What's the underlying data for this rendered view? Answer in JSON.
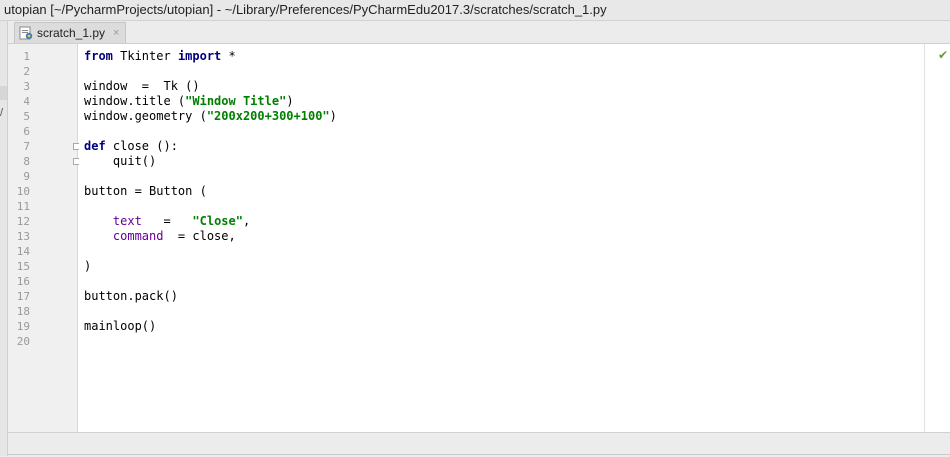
{
  "window": {
    "title": "utopian [~/PycharmProjects/utopian] - ~/Library/Preferences/PyCharmEdu2017.3/scratches/scratch_1.py"
  },
  "tabs": [
    {
      "label": "scratch_1.py",
      "close": "×",
      "icon": "python-file-icon"
    }
  ],
  "left_strip": {
    "marker": "/"
  },
  "editor": {
    "line_numbers": [
      "1",
      "2",
      "3",
      "4",
      "5",
      "6",
      "7",
      "8",
      "9",
      "10",
      "11",
      "12",
      "13",
      "14",
      "15",
      "16",
      "17",
      "18",
      "19",
      "20"
    ],
    "current_line": 20,
    "tokens": {
      "l1_from": "from",
      "l1_mid": " Tkinter ",
      "l1_import": "import",
      "l1_star": " *",
      "l3": "window  =  Tk ()",
      "l4_pre": "window.title (",
      "l4_str": "\"Window Title\"",
      "l4_post": ")",
      "l5_pre": "window.geometry (",
      "l5_str": "\"200x200+300+100\"",
      "l5_post": ")",
      "l7_def": "def",
      "l7_rest": " close ():",
      "l8": "    quit()",
      "l10": "button = Button (",
      "l12_indent": "    ",
      "l12_param": "text",
      "l12_mid": "   =   ",
      "l12_str": "\"Close\"",
      "l12_post": ",",
      "l13_indent": "    ",
      "l13_param": "command",
      "l13_rest": "  = close,",
      "l15": ")",
      "l17": "button.pack()",
      "l19": "mainloop()"
    }
  },
  "status": {
    "check_icon": "check-icon",
    "check_mark": "✔"
  },
  "colors": {
    "keyword": "#000080",
    "string": "#008000",
    "param": "#660099",
    "current_line": "#fffae3"
  }
}
